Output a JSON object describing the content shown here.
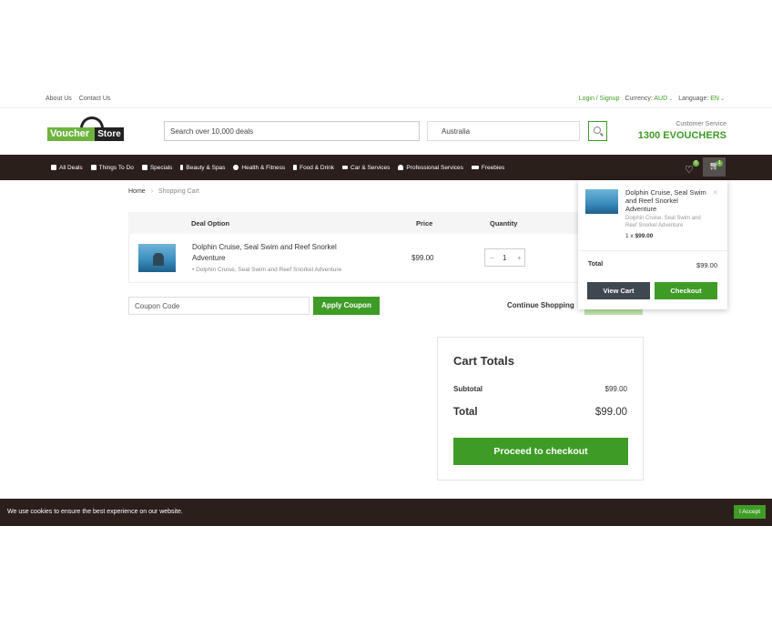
{
  "topbar": {
    "about": "About Us",
    "contact": "Contact Us",
    "login": "Login / Signup",
    "currency_label": "Currency:",
    "currency_value": "AUD",
    "language_label": "Language:",
    "language_value": "EN"
  },
  "header": {
    "logo_voucher": "Voucher",
    "logo_store": "Store",
    "search_placeholder": "Search over 10,000 deals",
    "location_value": "Australia",
    "customer_service_label": "Customer Service",
    "customer_service_phone": "1300 EVOUCHERS"
  },
  "nav": {
    "items": [
      {
        "label": "All Deals",
        "icon": "gift-icon"
      },
      {
        "label": "Things To Do",
        "icon": "person-icon"
      },
      {
        "label": "Specials",
        "icon": "gift-icon"
      },
      {
        "label": "Beauty & Spas",
        "icon": "bottle-icon"
      },
      {
        "label": "Health & Fitness",
        "icon": "fitness-icon"
      },
      {
        "label": "Food & Drink",
        "icon": "cutlery-icon"
      },
      {
        "label": "Car & Services",
        "icon": "car-icon"
      },
      {
        "label": "Professional Services",
        "icon": "user-icon"
      },
      {
        "label": "Freebies",
        "icon": "handshake-icon"
      }
    ],
    "wishlist_count": "0",
    "cart_count": "1"
  },
  "breadcrumb": {
    "home": "Home",
    "separator": "›",
    "current": "Shopping Cart"
  },
  "cart_table": {
    "headers": {
      "deal_option": "Deal Option",
      "price": "Price",
      "quantity": "Quantity"
    },
    "rows": [
      {
        "name": "Dolphin Cruise, Seal Swim and Reef Snorkel Adventure",
        "option": "Dolphin Cruise, Seal Swim and Reef Snorkel Adventure",
        "price": "$99.00",
        "quantity": "1",
        "minus": "−",
        "plus": "+"
      }
    ]
  },
  "coupon": {
    "placeholder": "Coupon Code",
    "apply_label": "Apply Coupon",
    "continue_label": "Continue Shopping"
  },
  "totals": {
    "title": "Cart Totals",
    "subtotal_label": "Subtotal",
    "subtotal_value": "$99.00",
    "total_label": "Total",
    "total_value": "$99.00",
    "proceed_label": "Proceed to checkout"
  },
  "mini_cart": {
    "item_name": "Dolphin Cruise, Seal Swim and Reef Snorkel Adventure",
    "item_option": "Dolphin Cruise, Seal Swim and Reef Snorkel Adventure",
    "item_qty": "1 x",
    "item_price": "$99.00",
    "close": "×",
    "total_label": "Total",
    "total_value": "$99.00",
    "view_cart_label": "View Cart",
    "checkout_label": "Checkout"
  },
  "cookie": {
    "message": "We use cookies to ensure the best experience on our website.",
    "accept_label": "I Accept"
  },
  "colors": {
    "brand_green": "#3e9c26",
    "nav_dark": "#2b1f1c"
  }
}
